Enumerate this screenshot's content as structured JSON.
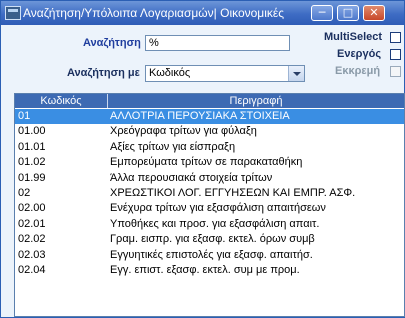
{
  "window": {
    "title": "Αναζήτηση/Υπόλοιπα Λογαριασμών| Οικονομικές",
    "minimize_glyph": "─",
    "maximize_glyph": "□",
    "close_glyph": "✕"
  },
  "search": {
    "label": "Αναζήτηση",
    "value": "%",
    "by_label": "Αναζήτηση με",
    "by_value": "Κωδικός"
  },
  "options": {
    "multiselect_label": "MultiSelect",
    "active_label": "Ενεργός",
    "pending_label": "Εκκρεμή"
  },
  "grid": {
    "columns": [
      "Κωδικός",
      "Περιγραφή"
    ],
    "rows": [
      {
        "code": "01",
        "desc": "ΑΛΛΟΤΡΙΑ ΠΕΡΟΥΣΙΑΚΑ ΣΤΟΙΧΕΙΑ",
        "selected": true
      },
      {
        "code": "01.00",
        "desc": "Χρεόγραφα τρίτων για φύλαξη"
      },
      {
        "code": "01.01",
        "desc": "Αξίες τρίτων για είσπραξη"
      },
      {
        "code": "01.02",
        "desc": "Εμπορεύματα τρίτων σε παρακαταθήκη"
      },
      {
        "code": "01.99",
        "desc": "Άλλα περουσιακά στοιχεία τρίτων"
      },
      {
        "code": "02",
        "desc": "ΧΡΕΩΣΤΙΚΟΙ ΛΟΓ. ΕΓΓΥΗΣΕΩΝ ΚΑΙ ΕΜΠΡ. ΑΣΦ."
      },
      {
        "code": "02.00",
        "desc": "Ενέχυρα τρίτων για εξασφάλιση απαιτήσεων"
      },
      {
        "code": "02.01",
        "desc": "Υποθήκες και προσ. για εξασφάλιση απαιτ."
      },
      {
        "code": "02.02",
        "desc": "Γραμ. εισπρ. για εξασφ. εκτελ. όρων συμβ"
      },
      {
        "code": "02.03",
        "desc": "Εγγυητικές επιστολές για εξασφ. απαιτήσ."
      },
      {
        "code": "02.04",
        "desc": "Εγγ. επιστ. εξασφ.  εκτελ. συμ με προμ."
      }
    ]
  }
}
